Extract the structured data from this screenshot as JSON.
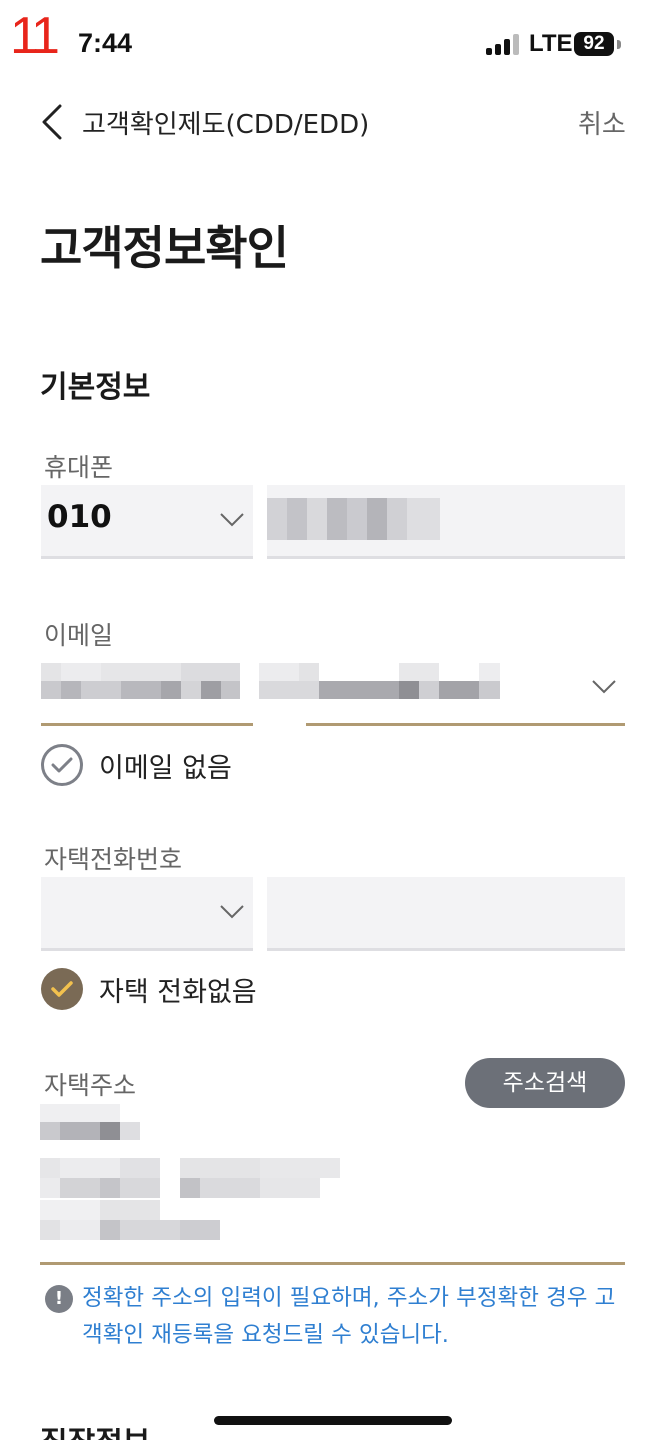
{
  "overlay": {
    "corner_number": "11"
  },
  "status_bar": {
    "time": "7:44",
    "network": "LTE",
    "battery": "92"
  },
  "nav": {
    "title": "고객확인제도(CDD/EDD)",
    "cancel_label": "취소"
  },
  "page_title": "고객정보확인",
  "basic_info": {
    "section_title": "기본정보",
    "phone": {
      "label": "휴대폰",
      "prefix_value": "010"
    },
    "email": {
      "label": "이메일",
      "no_email_label": "이메일 없음",
      "no_email_checked": false
    },
    "home_phone": {
      "label": "자택전화번호",
      "no_home_phone_label": "자택 전화없음",
      "no_home_phone_checked": true
    },
    "home_address": {
      "label": "자택주소",
      "search_button_label": "주소검색",
      "notice_text": "정확한 주소의 입력이 필요하며, 주소가 부정확한 경우 고객확인 재등록을 요청드릴 수 있습니다."
    }
  },
  "next_section_title": "직장정보",
  "colors": {
    "accent_gold": "#b09a72",
    "check_active": "#7a6a55",
    "check_mark": "#f2c14e",
    "notice_blue": "#2f7fd1",
    "button_gray": "#6c7078"
  }
}
